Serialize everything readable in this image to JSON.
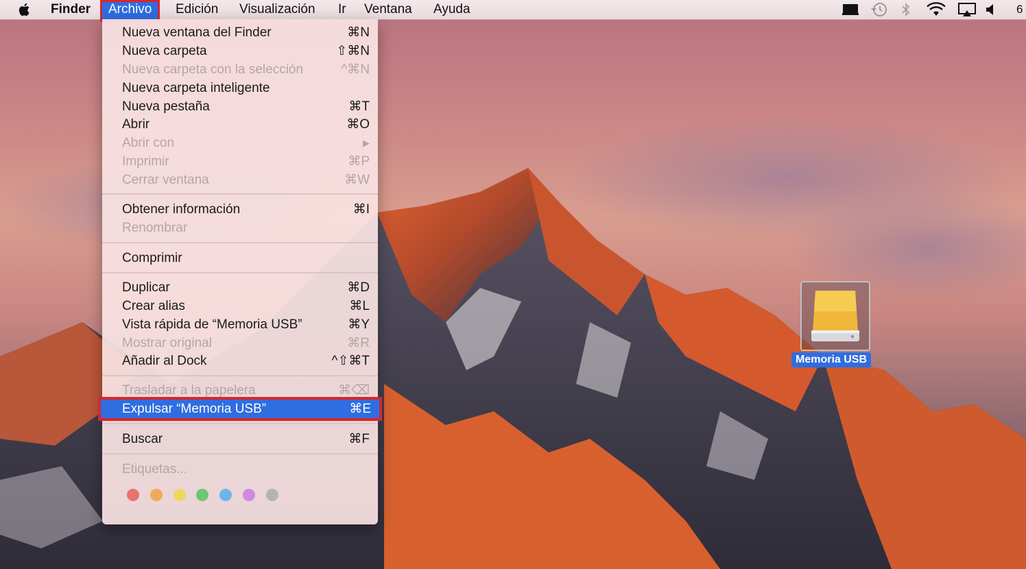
{
  "menubar": {
    "app_name": "Finder",
    "items": [
      "Archivo",
      "Edición",
      "Visualización",
      "Ir",
      "Ventana",
      "Ayuda"
    ],
    "battery_text": "6"
  },
  "file_menu": {
    "items": [
      {
        "label": "Nueva ventana del Finder",
        "shortcut": "⌘N",
        "enabled": true
      },
      {
        "label": "Nueva carpeta",
        "shortcut": "⇧⌘N",
        "enabled": true
      },
      {
        "label": "Nueva carpeta con la selección",
        "shortcut": "^⌘N",
        "enabled": false
      },
      {
        "label": "Nueva carpeta inteligente",
        "shortcut": "",
        "enabled": true
      },
      {
        "label": "Nueva pestaña",
        "shortcut": "⌘T",
        "enabled": true
      },
      {
        "label": "Abrir",
        "shortcut": "⌘O",
        "enabled": true
      },
      {
        "label": "Abrir con",
        "shortcut": "▶",
        "enabled": false
      },
      {
        "label": "Imprimir",
        "shortcut": "⌘P",
        "enabled": false
      },
      {
        "label": "Cerrar ventana",
        "shortcut": "⌘W",
        "enabled": false
      },
      {
        "label": "Obtener información",
        "shortcut": "⌘I",
        "enabled": true
      },
      {
        "label": "Renombrar",
        "shortcut": "",
        "enabled": false
      },
      {
        "label": "Comprimir",
        "shortcut": "",
        "enabled": true
      },
      {
        "label": "Duplicar",
        "shortcut": "⌘D",
        "enabled": true
      },
      {
        "label": "Crear alias",
        "shortcut": "⌘L",
        "enabled": true
      },
      {
        "label": "Vista rápida de “Memoria USB”",
        "shortcut": "⌘Y",
        "enabled": true
      },
      {
        "label": "Mostrar original",
        "shortcut": "⌘R",
        "enabled": false
      },
      {
        "label": "Añadir al Dock",
        "shortcut": "^⇧⌘T",
        "enabled": true
      },
      {
        "label": "Trasladar a la papelera",
        "shortcut": "⌘⌫",
        "enabled": false
      },
      {
        "label": "Expulsar “Memoria USB”",
        "shortcut": "⌘E",
        "enabled": true,
        "highlighted": true
      },
      {
        "label": "Buscar",
        "shortcut": "⌘F",
        "enabled": true
      },
      {
        "label": "Etiquetas...",
        "shortcut": "",
        "enabled": false
      }
    ],
    "tag_colors": [
      "#e8736f",
      "#eeaa5c",
      "#ecd760",
      "#6cc775",
      "#6ab6ea",
      "#cf8ae0",
      "#b3b3b3"
    ]
  },
  "desktop": {
    "usb_drive_label": "Memoria USB"
  },
  "colors": {
    "highlight": "#2f6de1",
    "annotation_box": "#d7262a"
  }
}
